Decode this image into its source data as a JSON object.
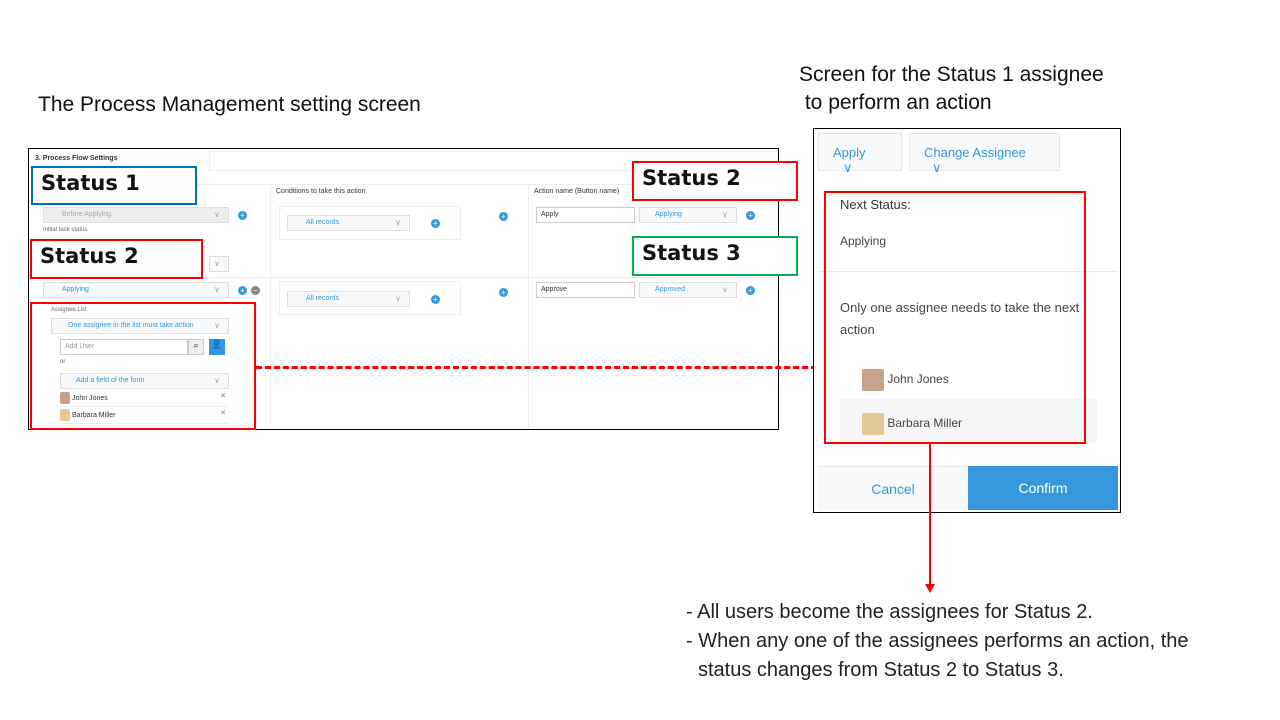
{
  "captions": {
    "left": "The Process Management setting screen",
    "right_line1": "Screen for the Status 1 assignee",
    "right_line2": "to perform an action"
  },
  "settings": {
    "section_title": "3. Process Flow Settings",
    "col_conditions": "Conditions to take this action",
    "col_action": "Action name (Button name)",
    "row1": {
      "status": "Before Applying",
      "initial_label": "Initial task status",
      "condition": "All records",
      "action": "Apply",
      "next": "Applying"
    },
    "row2": {
      "status": "Applying",
      "condition": "All records",
      "action": "Approve",
      "next": "Approved"
    },
    "assignee": {
      "label": "Assignee List",
      "mode": "One assignee in the list must take action",
      "add_user_placeholder": "Add User",
      "or": "or",
      "add_field": "Add a field of the form",
      "users": [
        "John Jones",
        "Barbara Miller"
      ]
    }
  },
  "labels": {
    "status1": "Status 1",
    "status2": "Status 2",
    "status2b": "Status 2",
    "status3": "Status 3"
  },
  "dialog": {
    "apply": "Apply",
    "change_assignee": "Change Assignee",
    "next_status_label": "Next Status:",
    "next_status": "Applying",
    "message": "Only one assignee needs to take the next action",
    "users": [
      "John Jones",
      "Barbara Miller"
    ],
    "cancel": "Cancel",
    "confirm": "Confirm"
  },
  "notes": [
    "- All users become the assignees for Status 2.",
    "- When any one of the assignees performs an action, the status changes from Status 2 to Status 3."
  ],
  "colors": {
    "red": "#ff0000",
    "blue": "#0070c0",
    "green": "#00b050",
    "accent": "#3498db"
  }
}
